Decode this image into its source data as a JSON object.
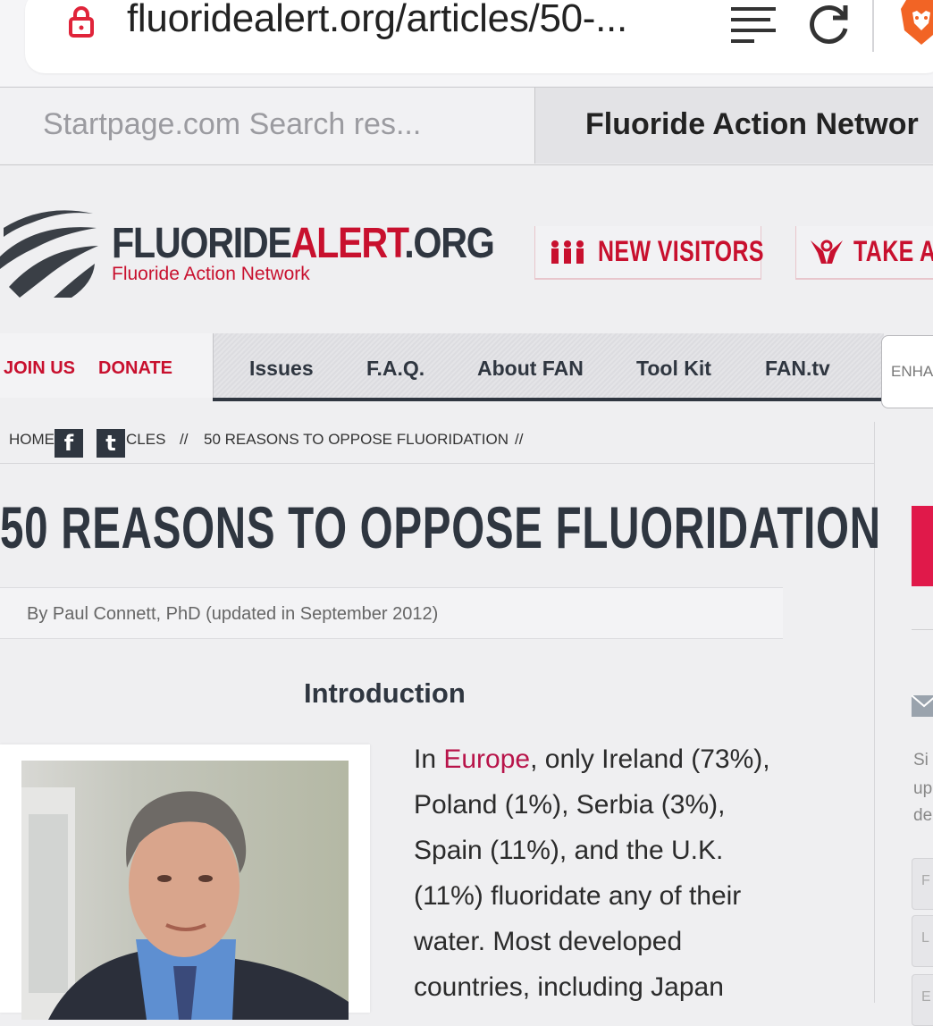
{
  "browser": {
    "url": "fluoridealert.org/articles/50-...",
    "tabs": [
      {
        "label": "Startpage.com Search res..."
      },
      {
        "label": "Fluoride Action Networ"
      }
    ]
  },
  "site": {
    "logo_dark": "FLUORIDE",
    "logo_red": "ALERT",
    "logo_tld": ".ORG",
    "logo_sub": "Fluoride Action Network",
    "header_buttons": [
      {
        "label": "NEW VISITORS"
      },
      {
        "label": "TAKE AC"
      }
    ]
  },
  "nav": {
    "left": [
      "JOIN US",
      "DONATE"
    ],
    "main": [
      "Issues",
      "F.A.Q.",
      "About FAN",
      "Tool Kit",
      "FAN.tv"
    ],
    "search_placeholder": "ENHA"
  },
  "breadcrumb": {
    "home": "HOME",
    "articles": "CLES",
    "sep1": "//",
    "current": "50 REASONS TO OPPOSE FLUORIDATION",
    "sep2": "//",
    "share": [
      "f",
      "t"
    ]
  },
  "article": {
    "title": "50 REASONS TO OPPOSE FLUORIDATION",
    "byline": "By Paul Connett, PhD (updated in September 2012)",
    "section": "Introduction",
    "lines": [
      {
        "pre": "In ",
        "link": "Europe",
        "post": ", only Ireland (73%),"
      },
      {
        "pre": "Poland (1%), Serbia (3%),",
        "link": "",
        "post": ""
      },
      {
        "pre": "Spain (11%), and the U.K.",
        "link": "",
        "post": ""
      },
      {
        "pre": "(11%) fluoridate any of their",
        "link": "",
        "post": ""
      },
      {
        "pre": "water. Most developed",
        "link": "",
        "post": ""
      },
      {
        "pre": "countries, including Japan",
        "link": "",
        "post": ""
      }
    ]
  },
  "sidebar": {
    "text": [
      "Si",
      "up",
      "de"
    ],
    "fields": [
      "F",
      "L",
      "E"
    ]
  },
  "colors": {
    "brand_red": "#c8102e",
    "dark": "#2f3640",
    "link": "#b8144a"
  }
}
